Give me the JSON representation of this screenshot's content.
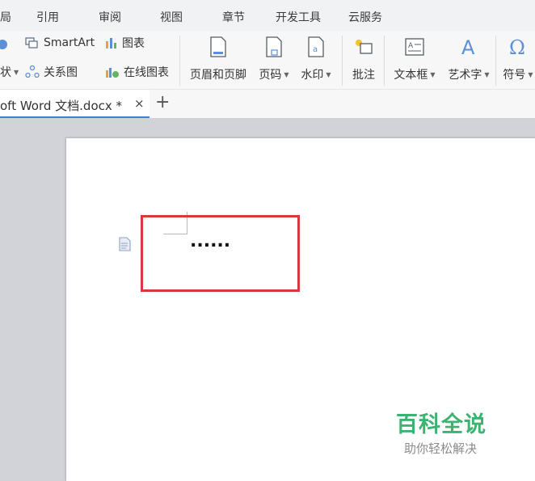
{
  "menubar": {
    "items": [
      "局",
      "引用",
      "审阅",
      "视图",
      "章节",
      "开发工具",
      "云服务"
    ]
  },
  "ribbon": {
    "smartart": "SmartArt",
    "chart": "图表",
    "style_partial": "状",
    "relation_chart": "关系图",
    "online_chart": "在线图表",
    "header_footer": "页眉和页脚",
    "page_number": "页码",
    "watermark": "水印",
    "comment": "批注",
    "text_box": "文本框",
    "word_art": "艺术字",
    "symbol": "符号"
  },
  "tabs": {
    "doc_title": "oft Word 文档.docx *",
    "close_glyph": "×",
    "new_tab_glyph": "+"
  },
  "document": {
    "text": "......"
  },
  "watermark": {
    "title": "百科全说",
    "subtitle": "助你轻松解决"
  },
  "colors": {
    "highlight": "#d9393d",
    "brand_green": "#3cb371",
    "tab_accent": "#3f7fd6"
  }
}
